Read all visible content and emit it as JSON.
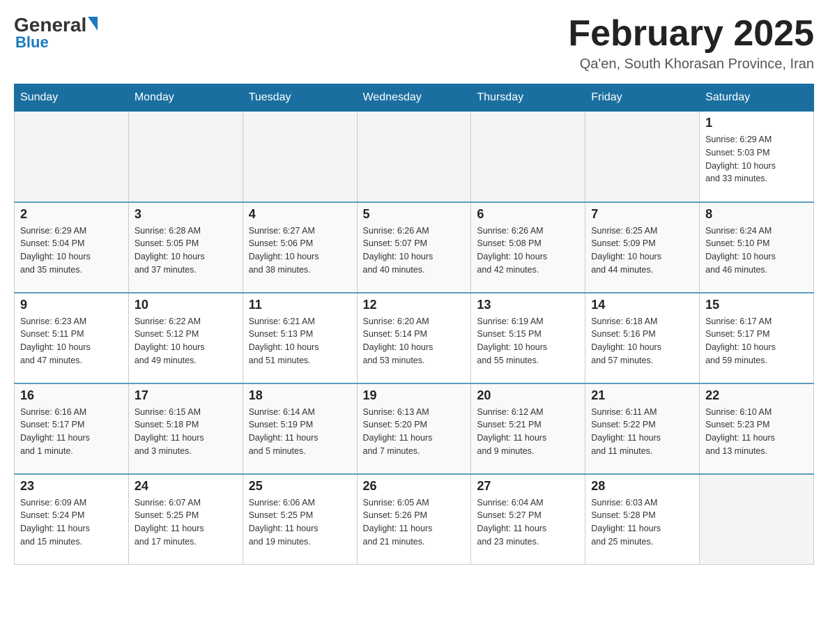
{
  "header": {
    "logo_general": "General",
    "logo_blue": "Blue",
    "month_title": "February 2025",
    "location": "Qa'en, South Khorasan Province, Iran"
  },
  "days_of_week": [
    "Sunday",
    "Monday",
    "Tuesday",
    "Wednesday",
    "Thursday",
    "Friday",
    "Saturday"
  ],
  "weeks": [
    [
      {
        "day": "",
        "info": ""
      },
      {
        "day": "",
        "info": ""
      },
      {
        "day": "",
        "info": ""
      },
      {
        "day": "",
        "info": ""
      },
      {
        "day": "",
        "info": ""
      },
      {
        "day": "",
        "info": ""
      },
      {
        "day": "1",
        "info": "Sunrise: 6:29 AM\nSunset: 5:03 PM\nDaylight: 10 hours\nand 33 minutes."
      }
    ],
    [
      {
        "day": "2",
        "info": "Sunrise: 6:29 AM\nSunset: 5:04 PM\nDaylight: 10 hours\nand 35 minutes."
      },
      {
        "day": "3",
        "info": "Sunrise: 6:28 AM\nSunset: 5:05 PM\nDaylight: 10 hours\nand 37 minutes."
      },
      {
        "day": "4",
        "info": "Sunrise: 6:27 AM\nSunset: 5:06 PM\nDaylight: 10 hours\nand 38 minutes."
      },
      {
        "day": "5",
        "info": "Sunrise: 6:26 AM\nSunset: 5:07 PM\nDaylight: 10 hours\nand 40 minutes."
      },
      {
        "day": "6",
        "info": "Sunrise: 6:26 AM\nSunset: 5:08 PM\nDaylight: 10 hours\nand 42 minutes."
      },
      {
        "day": "7",
        "info": "Sunrise: 6:25 AM\nSunset: 5:09 PM\nDaylight: 10 hours\nand 44 minutes."
      },
      {
        "day": "8",
        "info": "Sunrise: 6:24 AM\nSunset: 5:10 PM\nDaylight: 10 hours\nand 46 minutes."
      }
    ],
    [
      {
        "day": "9",
        "info": "Sunrise: 6:23 AM\nSunset: 5:11 PM\nDaylight: 10 hours\nand 47 minutes."
      },
      {
        "day": "10",
        "info": "Sunrise: 6:22 AM\nSunset: 5:12 PM\nDaylight: 10 hours\nand 49 minutes."
      },
      {
        "day": "11",
        "info": "Sunrise: 6:21 AM\nSunset: 5:13 PM\nDaylight: 10 hours\nand 51 minutes."
      },
      {
        "day": "12",
        "info": "Sunrise: 6:20 AM\nSunset: 5:14 PM\nDaylight: 10 hours\nand 53 minutes."
      },
      {
        "day": "13",
        "info": "Sunrise: 6:19 AM\nSunset: 5:15 PM\nDaylight: 10 hours\nand 55 minutes."
      },
      {
        "day": "14",
        "info": "Sunrise: 6:18 AM\nSunset: 5:16 PM\nDaylight: 10 hours\nand 57 minutes."
      },
      {
        "day": "15",
        "info": "Sunrise: 6:17 AM\nSunset: 5:17 PM\nDaylight: 10 hours\nand 59 minutes."
      }
    ],
    [
      {
        "day": "16",
        "info": "Sunrise: 6:16 AM\nSunset: 5:17 PM\nDaylight: 11 hours\nand 1 minute."
      },
      {
        "day": "17",
        "info": "Sunrise: 6:15 AM\nSunset: 5:18 PM\nDaylight: 11 hours\nand 3 minutes."
      },
      {
        "day": "18",
        "info": "Sunrise: 6:14 AM\nSunset: 5:19 PM\nDaylight: 11 hours\nand 5 minutes."
      },
      {
        "day": "19",
        "info": "Sunrise: 6:13 AM\nSunset: 5:20 PM\nDaylight: 11 hours\nand 7 minutes."
      },
      {
        "day": "20",
        "info": "Sunrise: 6:12 AM\nSunset: 5:21 PM\nDaylight: 11 hours\nand 9 minutes."
      },
      {
        "day": "21",
        "info": "Sunrise: 6:11 AM\nSunset: 5:22 PM\nDaylight: 11 hours\nand 11 minutes."
      },
      {
        "day": "22",
        "info": "Sunrise: 6:10 AM\nSunset: 5:23 PM\nDaylight: 11 hours\nand 13 minutes."
      }
    ],
    [
      {
        "day": "23",
        "info": "Sunrise: 6:09 AM\nSunset: 5:24 PM\nDaylight: 11 hours\nand 15 minutes."
      },
      {
        "day": "24",
        "info": "Sunrise: 6:07 AM\nSunset: 5:25 PM\nDaylight: 11 hours\nand 17 minutes."
      },
      {
        "day": "25",
        "info": "Sunrise: 6:06 AM\nSunset: 5:25 PM\nDaylight: 11 hours\nand 19 minutes."
      },
      {
        "day": "26",
        "info": "Sunrise: 6:05 AM\nSunset: 5:26 PM\nDaylight: 11 hours\nand 21 minutes."
      },
      {
        "day": "27",
        "info": "Sunrise: 6:04 AM\nSunset: 5:27 PM\nDaylight: 11 hours\nand 23 minutes."
      },
      {
        "day": "28",
        "info": "Sunrise: 6:03 AM\nSunset: 5:28 PM\nDaylight: 11 hours\nand 25 minutes."
      },
      {
        "day": "",
        "info": ""
      }
    ]
  ]
}
